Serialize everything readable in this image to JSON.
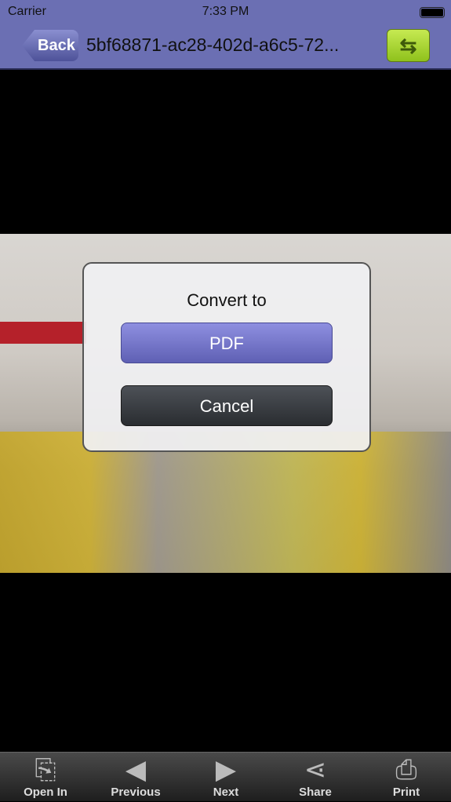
{
  "status": {
    "carrier": "Carrier",
    "time": "7:33 PM"
  },
  "nav": {
    "back_label": "Back",
    "title": "5bf68871-ac28-402d-a6c5-72...",
    "swap_icon": "swap-arrows-icon",
    "swap_color": "#a6d434"
  },
  "dialog": {
    "title": "Convert to",
    "pdf_label": "PDF",
    "cancel_label": "Cancel"
  },
  "toolbar": {
    "items": [
      {
        "label": "Open In",
        "icon": "open-in-icon"
      },
      {
        "label": "Previous",
        "icon": "previous-icon"
      },
      {
        "label": "Next",
        "icon": "next-icon"
      },
      {
        "label": "Share",
        "icon": "share-icon"
      },
      {
        "label": "Print",
        "icon": "print-icon"
      }
    ]
  },
  "colors": {
    "nav_bg": "#6b6fb3",
    "pdf_button": "#7475c8",
    "cancel_button": "#3a3d42"
  }
}
